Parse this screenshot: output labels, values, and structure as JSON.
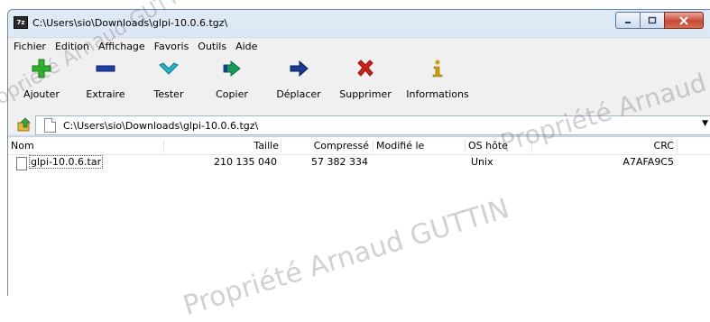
{
  "window": {
    "title": "C:\\Users\\sio\\Downloads\\glpi-10.0.6.tgz\\",
    "app_icon_text": "7z"
  },
  "menu": [
    "Fichier",
    "Edition",
    "Affichage",
    "Favoris",
    "Outils",
    "Aide"
  ],
  "toolbar": [
    {
      "label": "Ajouter",
      "icon": "plus-icon",
      "color": "#2db52b"
    },
    {
      "label": "Extraire",
      "icon": "minus-icon",
      "color": "#1e3ea8"
    },
    {
      "label": "Tester",
      "icon": "check-chevron-icon",
      "color": "#23b4c8"
    },
    {
      "label": "Copier",
      "icon": "double-arrow-icon",
      "color": "#1a9a5a"
    },
    {
      "label": "Déplacer",
      "icon": "arrow-right-icon",
      "color": "#1b3b8f"
    },
    {
      "label": "Supprimer",
      "icon": "x-icon",
      "color": "#d0201a"
    },
    {
      "label": "Informations",
      "icon": "info-icon",
      "color": "#c9a000"
    }
  ],
  "address": {
    "path": "C:\\Users\\sio\\Downloads\\glpi-10.0.6.tgz\\"
  },
  "columns": {
    "name": "Nom",
    "size": "Taille",
    "packed": "Compressé",
    "modified": "Modifié le",
    "host_os": "OS hôte",
    "crc": "CRC"
  },
  "files": [
    {
      "name": "glpi-10.0.6.tar",
      "size": "210 135 040",
      "packed": "57 382 334",
      "modified": "",
      "host_os": "Unix",
      "crc": "A7AFA9C5"
    }
  ],
  "watermark": {
    "text": "Propriété Arnaud GUTTIN"
  },
  "colors": {
    "titlebar": "#dfeaf6",
    "close": "#c74a33"
  }
}
